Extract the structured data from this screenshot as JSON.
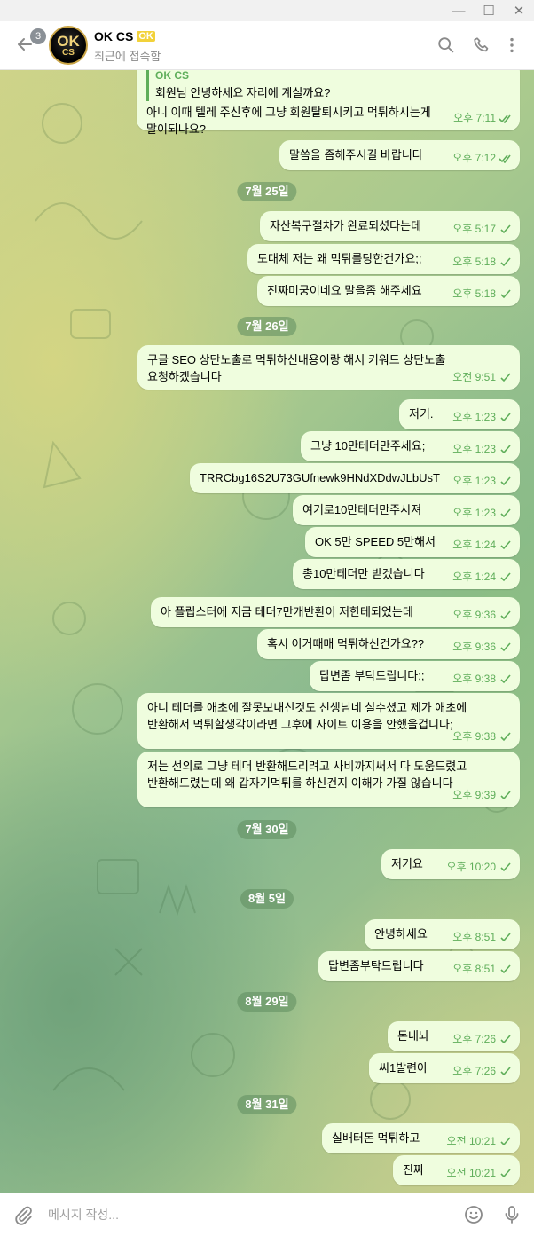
{
  "window": {
    "minimize": "—",
    "maximize": "☐",
    "close": "✕"
  },
  "header": {
    "back_badge": "3",
    "avatar_text": "OK",
    "avatar_sub": "CS",
    "title": "OK CS",
    "title_tag": "OK",
    "status": "최근에 접속함"
  },
  "chat": {
    "quoted": {
      "name": "OK CS",
      "text": "회원님 안녕하세요 자리에 계실까요?"
    },
    "messages": [
      {
        "text": "아니 이때 텔레 주신후에 그냥 회원탈퇴시키고 먹튀하시는게\n말이되나요?",
        "time": "오후 7:11",
        "read": true
      },
      {
        "text": "말씀을 좀해주시길 바랍니다",
        "time": "오후 7:12",
        "read": true
      },
      {
        "text": "자산복구절차가 완료되셨다는데",
        "time": "오후 5:17",
        "read": false
      },
      {
        "text": "도대체 저는 왜 먹튀를당한건가요;;",
        "time": "오후 5:18",
        "read": false
      },
      {
        "text": "진짜미궁이네요 말을좀 해주세요",
        "time": "오후 5:18",
        "read": false
      },
      {
        "text": "구글 SEO 상단노출로 먹튀하신내용이랑 해서 키워드 상단노출\n요청하겠습니다",
        "time": "오전 9:51",
        "read": false
      },
      {
        "text": "저기.",
        "time": "오후 1:23",
        "read": false
      },
      {
        "text": "그냥 10만테더만주세요;",
        "time": "오후 1:23",
        "read": false
      },
      {
        "text": "TRRCbg16S2U73GUfnewk9HNdXDdwJLbUsT",
        "time": "오후 1:23",
        "read": false
      },
      {
        "text": "여기로10만테더만주시져",
        "time": "오후 1:23",
        "read": false
      },
      {
        "text": "OK 5만 SPEED 5만해서",
        "time": "오후 1:24",
        "read": false
      },
      {
        "text": "총10만테더만 받겠습니다",
        "time": "오후 1:24",
        "read": false
      },
      {
        "text": "아 플립스터에 지금 테더7만개반환이 저한테되었는데",
        "time": "오후 9:36",
        "read": false
      },
      {
        "text": "혹시 이거때매 먹튀하신건가요??",
        "time": "오후 9:36",
        "read": false
      },
      {
        "text": "답변좀 부탁드립니다;;",
        "time": "오후 9:38",
        "read": false
      },
      {
        "text": "아니 테더를 애초에 잘못보내신것도 선생님네 실수셨고 제가 애초에\n반환해서 먹튀할생각이라면 그후에 사이트 이용을 안했을겁니다;",
        "time": "오후 9:38",
        "read": false
      },
      {
        "text": "저는 선의로 그냥 테더 반환해드리려고 사비까지써서 다 도움드렸고\n반환해드렸는데 왜 갑자기먹튀를 하신건지 이해가 가질 않습니다",
        "time": "오후 9:39",
        "read": false
      },
      {
        "text": "저기요",
        "time": "오후 10:20",
        "read": false
      },
      {
        "text": "안녕하세요",
        "time": "오후 8:51",
        "read": false
      },
      {
        "text": "답변좀부탁드립니다",
        "time": "오후 8:51",
        "read": false
      },
      {
        "text": "돈내놔",
        "time": "오후 7:26",
        "read": false
      },
      {
        "text": "씨1발련아",
        "time": "오후 7:26",
        "read": false
      },
      {
        "text": "실배터돈 먹튀하고",
        "time": "오전 10:21",
        "read": false
      },
      {
        "text": "진짜",
        "time": "오전 10:21",
        "read": false
      }
    ],
    "dates": [
      "7월 25일",
      "7월 26일",
      "7월 30일",
      "8월 5일",
      "8월 29일",
      "8월 31일"
    ]
  },
  "input": {
    "placeholder": "메시지 작성..."
  },
  "icons": {
    "back": "arrow-left-icon",
    "search": "search-icon",
    "call": "phone-icon",
    "more": "more-vertical-icon",
    "attach": "paperclip-icon",
    "emoji": "smile-icon",
    "mic": "microphone-icon"
  },
  "colors": {
    "bubble": "#effdde",
    "accent": "#5fae5a",
    "date_pill": "#5f8c5f"
  }
}
